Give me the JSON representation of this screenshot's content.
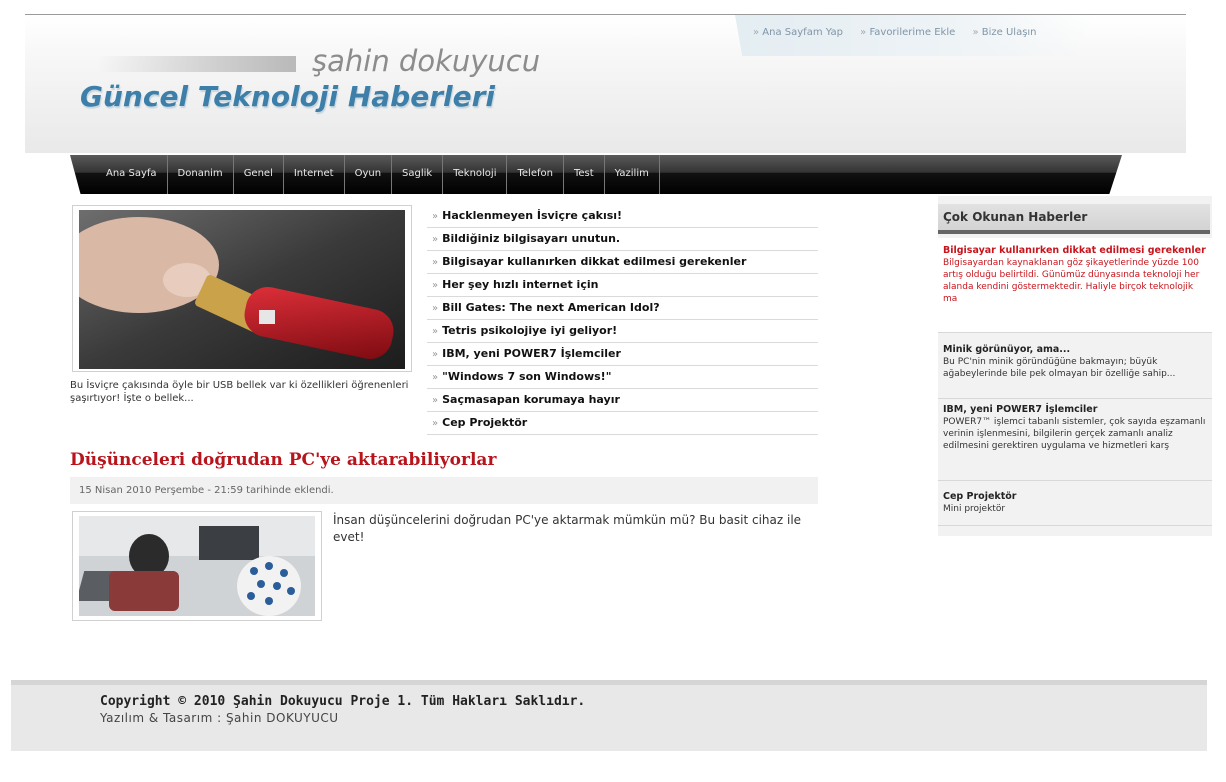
{
  "header": {
    "logo_sub": "şahin dokuyucu",
    "logo_main": "Güncel Teknoloji Haberleri",
    "top_links": [
      "Ana Sayfam Yap",
      "Favorilerime Ekle",
      "Bize Ulaşın"
    ]
  },
  "nav": [
    "Ana Sayfa",
    "Donanim",
    "Genel",
    "Internet",
    "Oyun",
    "Saglik",
    "Teknoloji",
    "Telefon",
    "Test",
    "Yazilim"
  ],
  "featured": {
    "caption": "Bu İsviçre çakısında öyle bir USB bellek var ki özellikleri öğrenenleri şaşırtıyor! İşte o bellek..."
  },
  "headlines": [
    "Hacklenmeyen İsviçre çakısı!",
    "Bildiğiniz bilgisayarı unutun.",
    "Bilgisayar kullanırken dikkat edilmesi gerekenler",
    "Her şey hızlı internet için",
    "Bill Gates: The next American Idol?",
    "Tetris psikolojiye iyi geliyor!",
    "IBM, yeni POWER7 İşlemciler",
    "\"Windows 7 son Windows!\"",
    "Saçmasapan korumaya hayır",
    "Cep Projektör"
  ],
  "article": {
    "title": "Düşünceleri doğrudan PC'ye aktarabiliyorlar",
    "meta": "15 Nisan 2010 Perşembe - 21:59 tarihinde eklendi.",
    "text": "İnsan düşüncelerini doğrudan PC'ye aktarmak mümkün mü? Bu basit cihaz ile evet!"
  },
  "sidebar": {
    "title": "Çok Okunan Haberler",
    "items": [
      {
        "title": "Bilgisayar kullanırken dikkat edilmesi gerekenler",
        "desc": "Bilgisayardan kaynaklanan göz şikayetlerinde yüzde 100 artış olduğu belirtildi. Günümüz dünyasında teknoloji her alanda kendini göstermektedir. Haliyle birçok teknolojik ma"
      },
      {
        "title": "Minik görünüyor, ama...",
        "desc": "Bu PC'nin minik göründüğüne bakmayın; büyük ağabeylerinde bile pek olmayan bir özelliğe sahip..."
      },
      {
        "title": "IBM, yeni POWER7 İşlemciler",
        "desc": "POWER7™ işlemci tabanlı sistemler, çok sayıda eşzamanlı verinin işlenmesini, bilgilerin gerçek zamanlı analiz edilmesini gerektiren uygulama ve hizmetleri karş"
      },
      {
        "title": "Cep Projektör",
        "desc": "Mini projektör"
      }
    ]
  },
  "footer": {
    "copyright": "Copyright © 2010 Şahin Dokuyucu Proje 1. Tüm Hakları Saklıdır.",
    "design": "Yazılım & Tasarım : Şahin DOKUYUCU"
  },
  "colors": {
    "accent_red": "#b8141c",
    "logo_blue": "#3d7fa8",
    "nav_black": "#111111"
  }
}
